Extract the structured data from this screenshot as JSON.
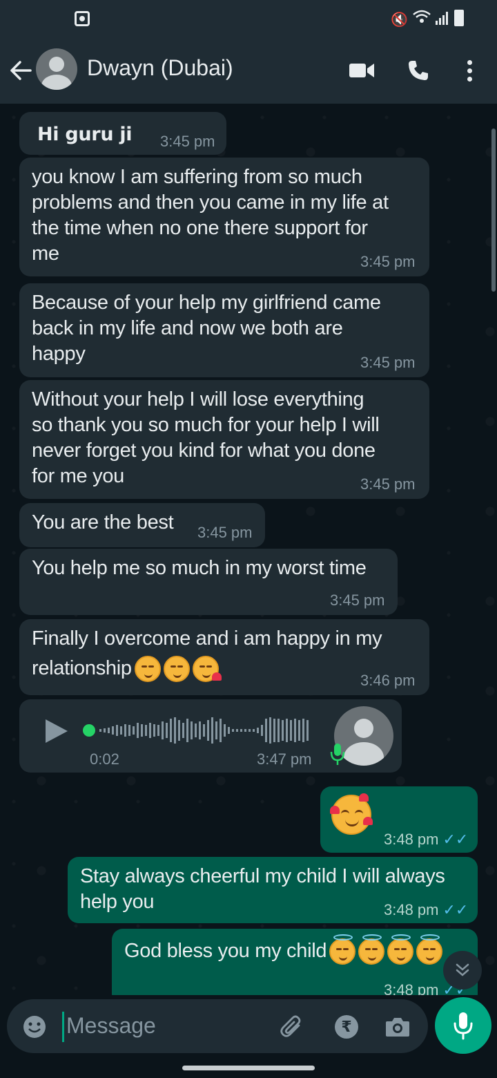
{
  "contact": {
    "name": "Dwayn (Dubai)"
  },
  "messages": [
    {
      "dir": "in",
      "text": "Hi guru ji",
      "time": "3:45 pm"
    },
    {
      "dir": "in",
      "lines": [
        "you know I am suffering from so much",
        "problems and then you came in my life at",
        "the time when no one there support for",
        "me"
      ],
      "time": "3:45 pm"
    },
    {
      "dir": "in",
      "lines": [
        "Because of your help my girlfriend came",
        "back in my life and now we both are",
        "happy"
      ],
      "time": "3:45 pm"
    },
    {
      "dir": "in",
      "lines": [
        "Without your help I will lose everything",
        "so thank you so much for your help I will",
        "never forget you kind for what you done",
        "for me you"
      ],
      "time": "3:45 pm"
    },
    {
      "dir": "in",
      "text": "You are the best",
      "time": "3:45 pm"
    },
    {
      "dir": "in",
      "text": "You help me so much in my worst time",
      "time": "3:45 pm"
    },
    {
      "dir": "in",
      "lines": [
        "Finally I overcome and i am happy in my",
        "relationship"
      ],
      "emojis": [
        "kissing-closed-eyes-emoji",
        "kissing-closed-eyes-emoji",
        "face-blowing-kiss-emoji"
      ],
      "time": "3:46 pm"
    },
    {
      "dir": "in",
      "type": "voice",
      "duration": "0:02",
      "time": "3:47 pm"
    },
    {
      "dir": "out",
      "type": "emoji",
      "emojis": [
        "smiling-face-with-hearts-emoji"
      ],
      "time": "3:48 pm"
    },
    {
      "dir": "out",
      "lines": [
        "Stay always cheerful my child I will always",
        "help you"
      ],
      "time": "3:48 pm"
    },
    {
      "dir": "out",
      "text": "God bless you my child",
      "emojis": [
        "smiling-face-with-halo-emoji",
        "smiling-face-with-halo-emoji",
        "smiling-face-with-halo-emoji",
        "smiling-face-with-halo-emoji"
      ],
      "time": "3:48 pm"
    }
  ],
  "composer": {
    "placeholder": "Message"
  },
  "icons": {
    "back": "arrow-left-icon",
    "avatar": "avatar-icon",
    "video": "video-call-icon",
    "call": "phone-icon",
    "menu": "more-vert-icon",
    "emoji": "emoji-icon",
    "attach": "paperclip-icon",
    "pay": "rupee-icon",
    "camera": "camera-icon",
    "mic": "mic-icon",
    "scroll": "double-chevron-down-icon"
  },
  "colors": {
    "bg": "#0b141a",
    "bar": "#1f2c34",
    "incoming": "#202c33",
    "outgoing": "#005c4b",
    "accent": "#00a884",
    "read_ticks": "#53bdeb"
  }
}
